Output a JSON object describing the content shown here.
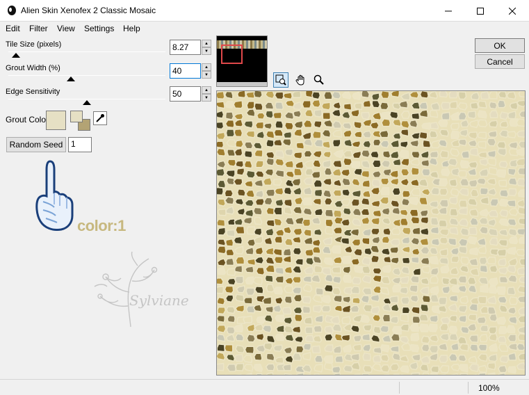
{
  "window": {
    "title": "Alien Skin Xenofex 2 Classic Mosaic"
  },
  "menu": [
    "Edit",
    "Filter",
    "View",
    "Settings",
    "Help"
  ],
  "params": {
    "tile_size": {
      "label": "Tile Size (pixels)",
      "value": "8.27",
      "slider_fraction": 0.05
    },
    "grout_width": {
      "label": "Grout Width (%)",
      "value": "40",
      "slider_fraction": 0.4
    },
    "edge_sensitivity": {
      "label": "Edge Sensitivity",
      "value": "50",
      "slider_fraction": 0.5
    }
  },
  "grout_color": {
    "label": "Grout Color",
    "color": "#e6e0c4",
    "fg_color": "#e6e0c4",
    "bg_color": "#b3a374"
  },
  "random_seed": {
    "button": "Random Seed",
    "value": "1"
  },
  "annotation": {
    "text": "color:1",
    "signature": "Sylviane"
  },
  "buttons": {
    "ok": "OK",
    "cancel": "Cancel"
  },
  "status": {
    "zoom": "100%"
  },
  "colors": {
    "accent": "#0078d7",
    "annotation": "#c7b87f"
  }
}
